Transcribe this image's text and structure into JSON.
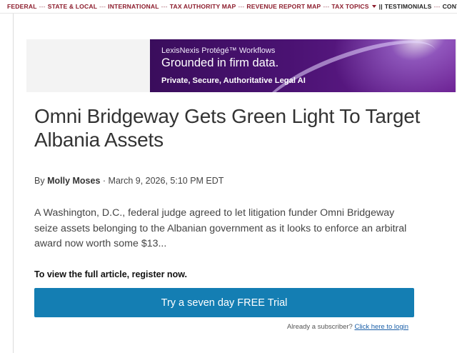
{
  "topnav": {
    "items": [
      "FEDERAL",
      "STATE & LOCAL",
      "INTERNATIONAL",
      "TAX AUTHORITY MAP",
      "REVENUE REPORT MAP",
      "TAX TOPICS",
      "TESTIMONIALS",
      "CONTA"
    ],
    "separator": "---",
    "pipes": "||"
  },
  "ad": {
    "kicker": "LexisNexis Protégé™ Workflows",
    "headline": "Grounded in firm data.",
    "subline": "Private, Secure, Authoritative Legal AI"
  },
  "article": {
    "title": "Omni Bridgeway Gets Green Light To Target Albania Assets",
    "byline_prefix": "By",
    "author": "Molly Moses",
    "byline_separator": "·",
    "date": "March 9, 2026, 5:10 PM EDT",
    "summary": "A Washington, D.C., federal judge agreed to let litigation funder Omni Bridgeway seize assets belonging to the Albanian government as it looks to enforce an arbitral award now worth some $13..."
  },
  "paywall": {
    "register_text": "To view the full article, register now.",
    "trial_button": "Try a seven day FREE Trial",
    "subscriber_text": "Already a subscriber?",
    "login_link": "Click here to login"
  },
  "colors": {
    "nav_link": "#8c1c2c",
    "button": "#147eb3",
    "ad_background": "#4a1272"
  }
}
